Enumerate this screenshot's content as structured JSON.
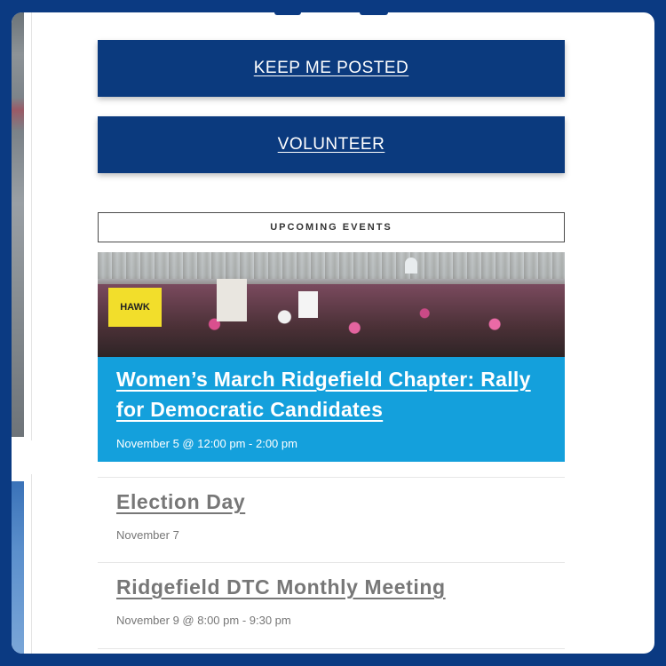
{
  "actions": {
    "keep_posted_label": "KEEP ME POSTED",
    "volunteer_label": "VOLUNTEER"
  },
  "events": {
    "header": "UPCOMING EVENTS",
    "featured": {
      "image_sign_text": "HAWK",
      "title": "Women’s March Ridgefield Chapter: Rally for Democratic Candidates",
      "date": "November 5 @ 12:00 pm - 2:00 pm"
    },
    "list": [
      {
        "title": "Election Day",
        "date": "November 7"
      },
      {
        "title": "Ridgefield DTC Monthly Meeting",
        "date": "November 9 @ 8:00 pm - 9:30 pm"
      }
    ]
  },
  "colors": {
    "page_bg": "#0b3a82",
    "button_bg": "#0b3a7e",
    "featured_bg": "#14a0dc",
    "event_text": "#777777"
  }
}
